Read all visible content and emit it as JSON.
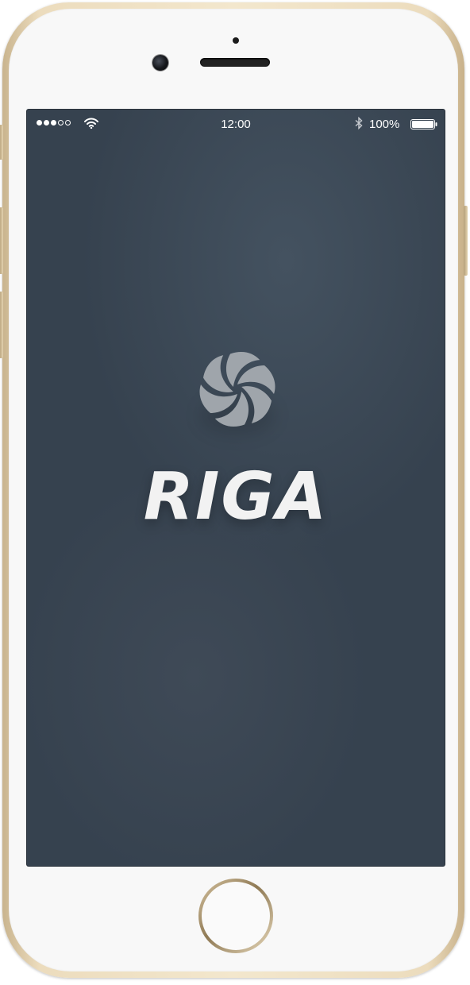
{
  "status_bar": {
    "signal_bars_filled": 3,
    "signal_bars_total": 5,
    "wifi_icon": "wifi-icon",
    "time": "12:00",
    "bluetooth_icon": "bluetooth-icon",
    "battery_percent": "100%",
    "battery_icon": "battery-icon",
    "battery_level": 1.0
  },
  "splash": {
    "logo_icon": "swirl-logo-icon",
    "app_name": "RIGA"
  },
  "colors": {
    "screen_background": "#36424f",
    "logo_mark": "#9fa5ab",
    "wordmark": "#f2f2f2",
    "device_frame": "#ecdcbd"
  }
}
